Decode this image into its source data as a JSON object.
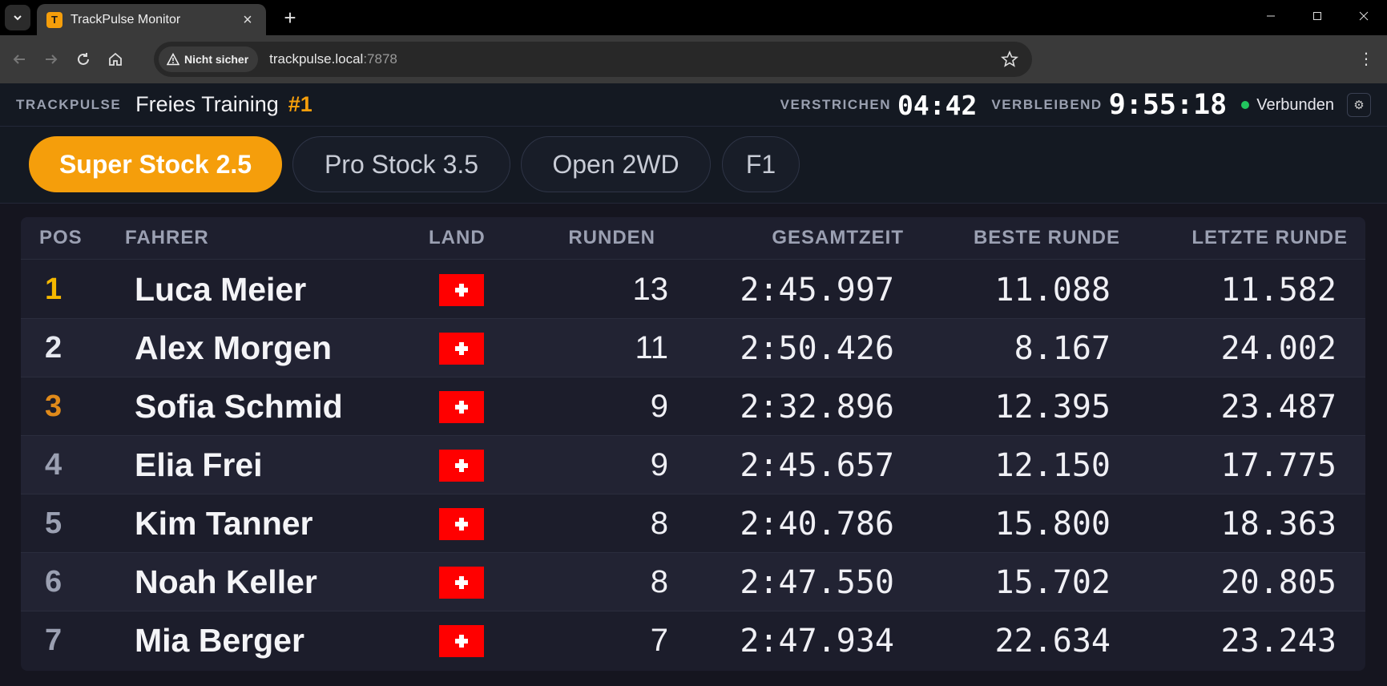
{
  "browser": {
    "tab_title": "TrackPulse Monitor",
    "favicon_letter": "T",
    "security_label": "Nicht sicher",
    "url_host": "trackpulse.local",
    "url_port": ":7878"
  },
  "header": {
    "brand": "TRACKPULSE",
    "session_title": "Freies Training",
    "session_number": "#1",
    "elapsed_label": "VERSTRICHEN",
    "elapsed_value": "04:42",
    "remaining_label": "VERBLEIBEND",
    "remaining_value": "9:55:18",
    "connection_status": "Verbunden",
    "status_color": "#22c55e",
    "accent_color": "#f59e0b"
  },
  "class_tabs": [
    {
      "label": "Super Stock 2.5",
      "active": true
    },
    {
      "label": "Pro Stock 3.5",
      "active": false
    },
    {
      "label": "Open 2WD",
      "active": false
    },
    {
      "label": "F1",
      "active": false
    }
  ],
  "table": {
    "columns": {
      "pos": "POS",
      "driver": "FAHRER",
      "country": "LAND",
      "laps": "RUNDEN",
      "total": "GESAMTZEIT",
      "best": "BESTE RUNDE",
      "last": "LETZTE RUNDE"
    },
    "rows": [
      {
        "pos": "1",
        "driver": "Luca Meier",
        "country": "switzerland-flag",
        "laps": "13",
        "total": "2:45.997",
        "best": "11.088",
        "last": "11.582"
      },
      {
        "pos": "2",
        "driver": "Alex Morgen",
        "country": "switzerland-flag",
        "laps": "11",
        "total": "2:50.426",
        "best": "8.167",
        "last": "24.002"
      },
      {
        "pos": "3",
        "driver": "Sofia Schmid",
        "country": "switzerland-flag",
        "laps": "9",
        "total": "2:32.896",
        "best": "12.395",
        "last": "23.487"
      },
      {
        "pos": "4",
        "driver": "Elia Frei",
        "country": "switzerland-flag",
        "laps": "9",
        "total": "2:45.657",
        "best": "12.150",
        "last": "17.775"
      },
      {
        "pos": "5",
        "driver": "Kim Tanner",
        "country": "switzerland-flag",
        "laps": "8",
        "total": "2:40.786",
        "best": "15.800",
        "last": "18.363"
      },
      {
        "pos": "6",
        "driver": "Noah Keller",
        "country": "switzerland-flag",
        "laps": "8",
        "total": "2:47.550",
        "best": "15.702",
        "last": "20.805"
      },
      {
        "pos": "7",
        "driver": "Mia Berger",
        "country": "switzerland-flag",
        "laps": "7",
        "total": "2:47.934",
        "best": "22.634",
        "last": "23.243"
      }
    ]
  }
}
